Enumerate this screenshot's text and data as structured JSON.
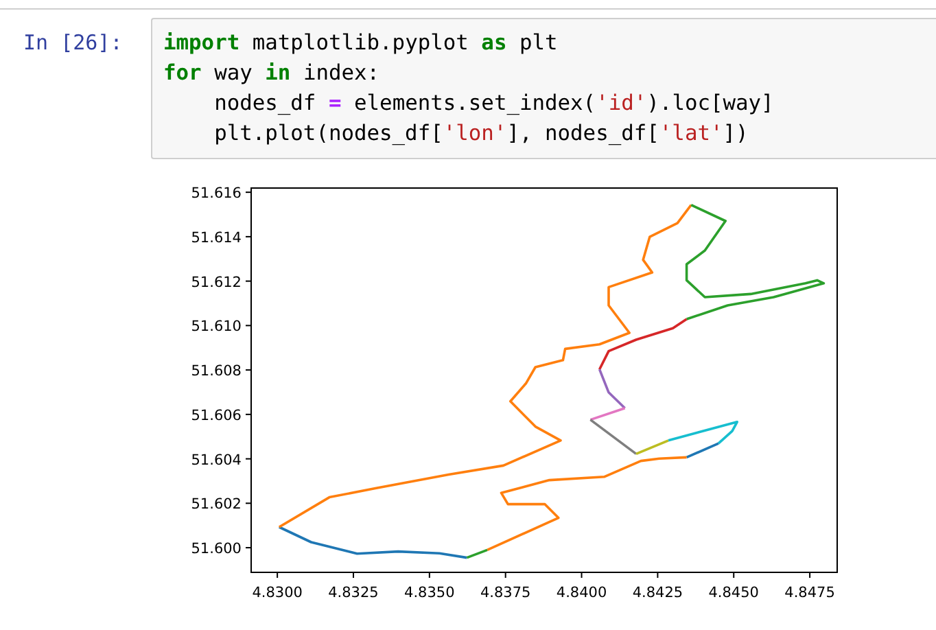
{
  "cell": {
    "prompt": "In [26]:",
    "code": [
      [
        {
          "kind": "keyword",
          "text": "import"
        },
        {
          "kind": "plain",
          "text": " matplotlib.pyplot "
        },
        {
          "kind": "keyword",
          "text": "as"
        },
        {
          "kind": "plain",
          "text": " plt"
        }
      ],
      [
        {
          "kind": "keyword",
          "text": "for"
        },
        {
          "kind": "plain",
          "text": " way "
        },
        {
          "kind": "keyword",
          "text": "in"
        },
        {
          "kind": "plain",
          "text": " index:"
        }
      ],
      [
        {
          "kind": "plain",
          "text": "    nodes_df "
        },
        {
          "kind": "operator",
          "text": "="
        },
        {
          "kind": "plain",
          "text": " elements.set_index("
        },
        {
          "kind": "string",
          "text": "'id'"
        },
        {
          "kind": "plain",
          "text": ").loc[way]"
        }
      ],
      [
        {
          "kind": "plain",
          "text": "    plt.plot(nodes_df["
        },
        {
          "kind": "string",
          "text": "'lon'"
        },
        {
          "kind": "plain",
          "text": "], nodes_df["
        },
        {
          "kind": "string",
          "text": "'lat'"
        },
        {
          "kind": "plain",
          "text": "])"
        }
      ]
    ]
  },
  "output": {
    "chart_data": {
      "type": "line",
      "xlim": [
        4.82914,
        4.8484
      ],
      "ylim": [
        51.59889,
        51.61619
      ],
      "xticks": [
        {
          "value": 4.83,
          "label": "4.8300"
        },
        {
          "value": 4.8325,
          "label": "4.8325"
        },
        {
          "value": 4.835,
          "label": "4.8350"
        },
        {
          "value": 4.8375,
          "label": "4.8375"
        },
        {
          "value": 4.84,
          "label": "4.8400"
        },
        {
          "value": 4.8425,
          "label": "4.8425"
        },
        {
          "value": 4.845,
          "label": "4.8450"
        },
        {
          "value": 4.8475,
          "label": "4.8475"
        }
      ],
      "yticks": [
        {
          "value": 51.6,
          "label": "51.600"
        },
        {
          "value": 51.602,
          "label": "51.602"
        },
        {
          "value": 51.604,
          "label": "51.604"
        },
        {
          "value": 51.606,
          "label": "51.606"
        },
        {
          "value": 51.608,
          "label": "51.608"
        },
        {
          "value": 51.61,
          "label": "51.610"
        },
        {
          "value": 51.612,
          "label": "51.612"
        },
        {
          "value": 51.614,
          "label": "51.614"
        },
        {
          "value": 51.616,
          "label": "51.616"
        }
      ],
      "series": [
        {
          "color": "#1f77b4",
          "x": [
            4.83006,
            4.83111,
            4.83262,
            4.83397,
            4.83533,
            4.83623
          ],
          "values": [
            51.60093,
            51.60025,
            51.59973,
            51.59983,
            51.59975,
            51.59955
          ]
        },
        {
          "color": "#ff7f0e",
          "x": [
            4.83006,
            4.83171,
            4.83322,
            4.83563,
            4.83743,
            4.83931,
            4.83848,
            4.83766,
            4.83818,
            4.83848,
            4.83939,
            4.83946,
            4.84059,
            4.84157,
            4.84089,
            4.84089,
            4.84232,
            4.84202,
            4.84224,
            4.84315,
            4.8436
          ],
          "values": [
            51.60093,
            51.60227,
            51.60267,
            51.60329,
            51.6037,
            51.60483,
            51.60545,
            51.60659,
            51.60741,
            51.60813,
            51.60844,
            51.60895,
            51.60915,
            51.60967,
            51.61091,
            51.61173,
            51.61239,
            51.61296,
            51.61399,
            51.61461,
            51.61543
          ]
        },
        {
          "color": "#2ca02c",
          "x": [
            4.8436,
            4.84473,
            4.84405,
            4.84345,
            4.84345,
            4.84405,
            4.84556,
            4.84736,
            4.84774,
            4.84796,
            4.84631,
            4.8448,
            4.84345
          ],
          "values": [
            51.61543,
            51.61471,
            51.61338,
            51.61276,
            51.61204,
            51.61128,
            51.61142,
            51.6119,
            51.61204,
            51.6119,
            51.61128,
            51.61091,
            51.61029
          ]
        },
        {
          "color": "#d62728",
          "x": [
            4.84345,
            4.843,
            4.84179,
            4.84089,
            4.84059
          ],
          "values": [
            51.61029,
            51.60988,
            51.60936,
            51.60885,
            51.60803
          ]
        },
        {
          "color": "#9467bd",
          "x": [
            4.84059,
            4.84089,
            4.84142
          ],
          "values": [
            51.60803,
            51.60699,
            51.60628
          ]
        },
        {
          "color": "#e377c2",
          "x": [
            4.84142,
            4.84029
          ],
          "values": [
            51.60628,
            51.60576
          ]
        },
        {
          "color": "#7f7f7f",
          "x": [
            4.84029,
            4.84179
          ],
          "values": [
            51.60576,
            51.60422
          ]
        },
        {
          "color": "#bcbd22",
          "x": [
            4.84179,
            4.84285
          ],
          "values": [
            51.60422,
            51.60483
          ]
        },
        {
          "color": "#17becf",
          "x": [
            4.84285,
            4.84511,
            4.84495,
            4.8445
          ],
          "values": [
            51.60483,
            51.60566,
            51.60525,
            51.60469
          ]
        },
        {
          "color": "#1f77b4",
          "x": [
            4.8445,
            4.84345
          ],
          "values": [
            51.60469,
            51.60407
          ]
        },
        {
          "color": "#ff7f0e",
          "x": [
            4.8369,
            4.83924,
            4.83879,
            4.83758,
            4.83736,
            4.83894,
            4.84074,
            4.84195,
            4.84255,
            4.84345
          ],
          "values": [
            51.5999,
            51.60134,
            51.60196,
            51.60196,
            51.60247,
            51.60304,
            51.60319,
            51.60391,
            51.60401,
            51.60407
          ]
        },
        {
          "color": "#2ca02c",
          "x": [
            4.83623,
            4.8369
          ],
          "values": [
            51.59955,
            51.5999
          ]
        }
      ]
    }
  }
}
